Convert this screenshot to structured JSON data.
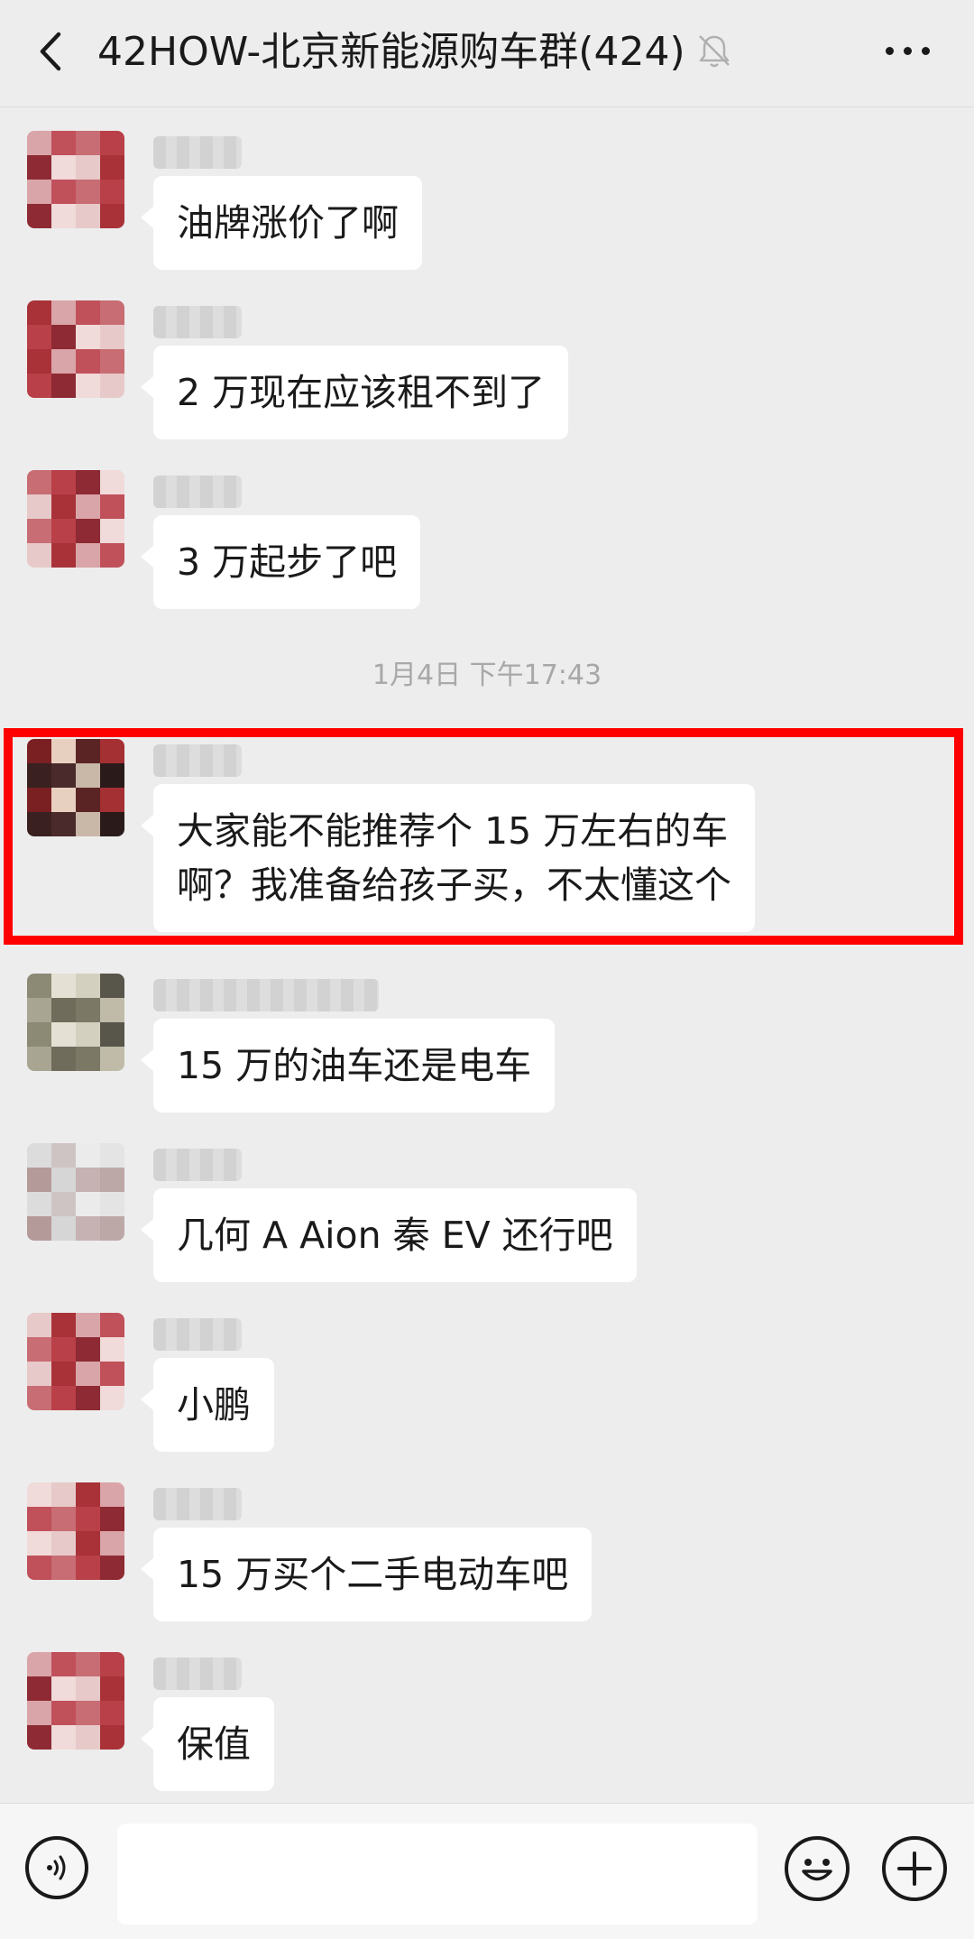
{
  "header": {
    "title": "42HOW-北京新能源购车群(424)",
    "back_icon": "chevron-left-icon",
    "mute_icon": "bell-muted-icon",
    "more_icon": "more-dots-icon"
  },
  "timestamp": "1月4日 下午17:43",
  "messages": [
    {
      "text": "油牌涨价了啊",
      "avatar_style": "pink-red"
    },
    {
      "text": "2 万现在应该租不到了",
      "avatar_style": "pink-red"
    },
    {
      "text": "3 万起步了吧",
      "avatar_style": "pink-red"
    },
    {
      "text": "大家能不能推荐个 15 万左右的车\n啊？我准备给孩子买，不太懂这个",
      "avatar_style": "dark-red",
      "highlighted": true
    },
    {
      "text": "15 万的油车还是电车",
      "avatar_style": "gray-olive"
    },
    {
      "text": "几何 A Aion 秦 EV 还行吧",
      "avatar_style": "light-gray"
    },
    {
      "text": "小鹏",
      "avatar_style": "pink-red"
    },
    {
      "text": "15 万买个二手电动车吧",
      "avatar_style": "pink-red"
    },
    {
      "text": "保值",
      "avatar_style": "pink-red"
    }
  ],
  "input": {
    "voice_icon": "voice-icon",
    "emoji_icon": "emoji-icon",
    "plus_icon": "plus-icon",
    "value": ""
  },
  "colors": {
    "background": "#ededed",
    "bubble": "#ffffff",
    "highlight": "#ff0000",
    "text": "#1a1a1a",
    "timestamp": "#a8a8a8"
  }
}
